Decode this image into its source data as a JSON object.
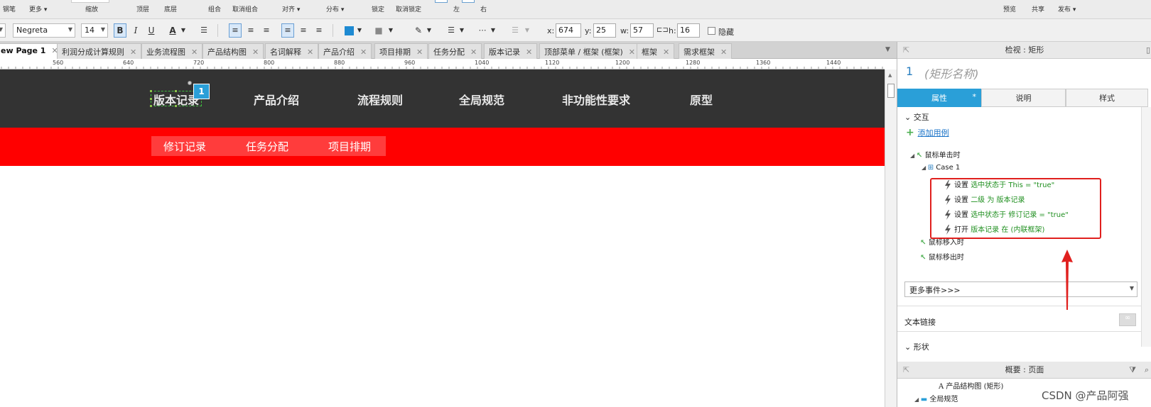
{
  "toolbar_top": {
    "items": [
      "钢笔",
      "更多 ▾",
      "缩放",
      "顶层",
      "底层",
      "组合",
      "取消组合",
      "对齐 ▾",
      "分布 ▾",
      "锁定",
      "取消锁定",
      "左",
      "右",
      "预览",
      "共享",
      "发布 ▾"
    ]
  },
  "toolbar_format": {
    "font_family": "Negreta",
    "font_size": "14",
    "bold": "B",
    "italic": "I",
    "underline": "U",
    "font_color_glyph": "A",
    "fill_color": "#1e8ad2",
    "x_label": "x:",
    "x_value": "674",
    "y_label": "y:",
    "y_value": "25",
    "w_label": "w:",
    "w_value": "57",
    "h_label": "h:",
    "h_value": "16",
    "hide_label": "隐藏"
  },
  "tabs": [
    {
      "label": "ew Page 1",
      "active": true
    },
    {
      "label": "利润分成计算规则"
    },
    {
      "label": "业务流程图"
    },
    {
      "label": "产品结构图"
    },
    {
      "label": "名词解释"
    },
    {
      "label": "产品介绍"
    },
    {
      "label": "项目排期"
    },
    {
      "label": "任务分配"
    },
    {
      "label": "版本记录"
    },
    {
      "label": "顶部菜单 / 框架 (框架)"
    },
    {
      "label": "框架"
    },
    {
      "label": "需求框架"
    }
  ],
  "tab_close": "✕",
  "ruler": [
    "560",
    "640",
    "720",
    "800",
    "880",
    "960",
    "1040",
    "1120",
    "1200",
    "1280",
    "1360",
    "1440"
  ],
  "canvas": {
    "nav_items": [
      "版本记录",
      "产品介绍",
      "流程规则",
      "全局规范",
      "非功能性要求",
      "原型"
    ],
    "selected_badge": "1",
    "sub_items": [
      "修订记录",
      "任务分配",
      "项目排期"
    ],
    "nav_bg": "#333333",
    "red_bg": "#ff0000"
  },
  "inspector": {
    "header": "检视 : 矩形",
    "shape_number": "1",
    "shape_name": "(矩形名称)",
    "tabs": [
      "属性",
      "说明",
      "样式"
    ],
    "tab_star": "*",
    "section_interaction": "交互",
    "add_case": "添加用例",
    "event_click": "鼠标单击时",
    "case_name": "Case 1",
    "actions": [
      {
        "verb": "设置",
        "detail": "选中状态于 This = \"true\""
      },
      {
        "verb": "设置",
        "detail": "二级 为 版本记录"
      },
      {
        "verb": "设置",
        "detail": "选中状态于 修订记录 = \"true\""
      },
      {
        "verb": "打开",
        "detail": "版本记录 在 (内联框架)"
      }
    ],
    "event_enter": "鼠标移入时",
    "event_leave": "鼠标移出时",
    "more_events": "更多事件>>>",
    "text_link": "文本链接",
    "section_shape": "形状"
  },
  "overview": {
    "header": "概要 : 页面",
    "items": [
      "产品结构图 (矩形)",
      "全局规范"
    ]
  },
  "watermark": "CSDN @产品阿强",
  "highlight_color": "#e0201e"
}
